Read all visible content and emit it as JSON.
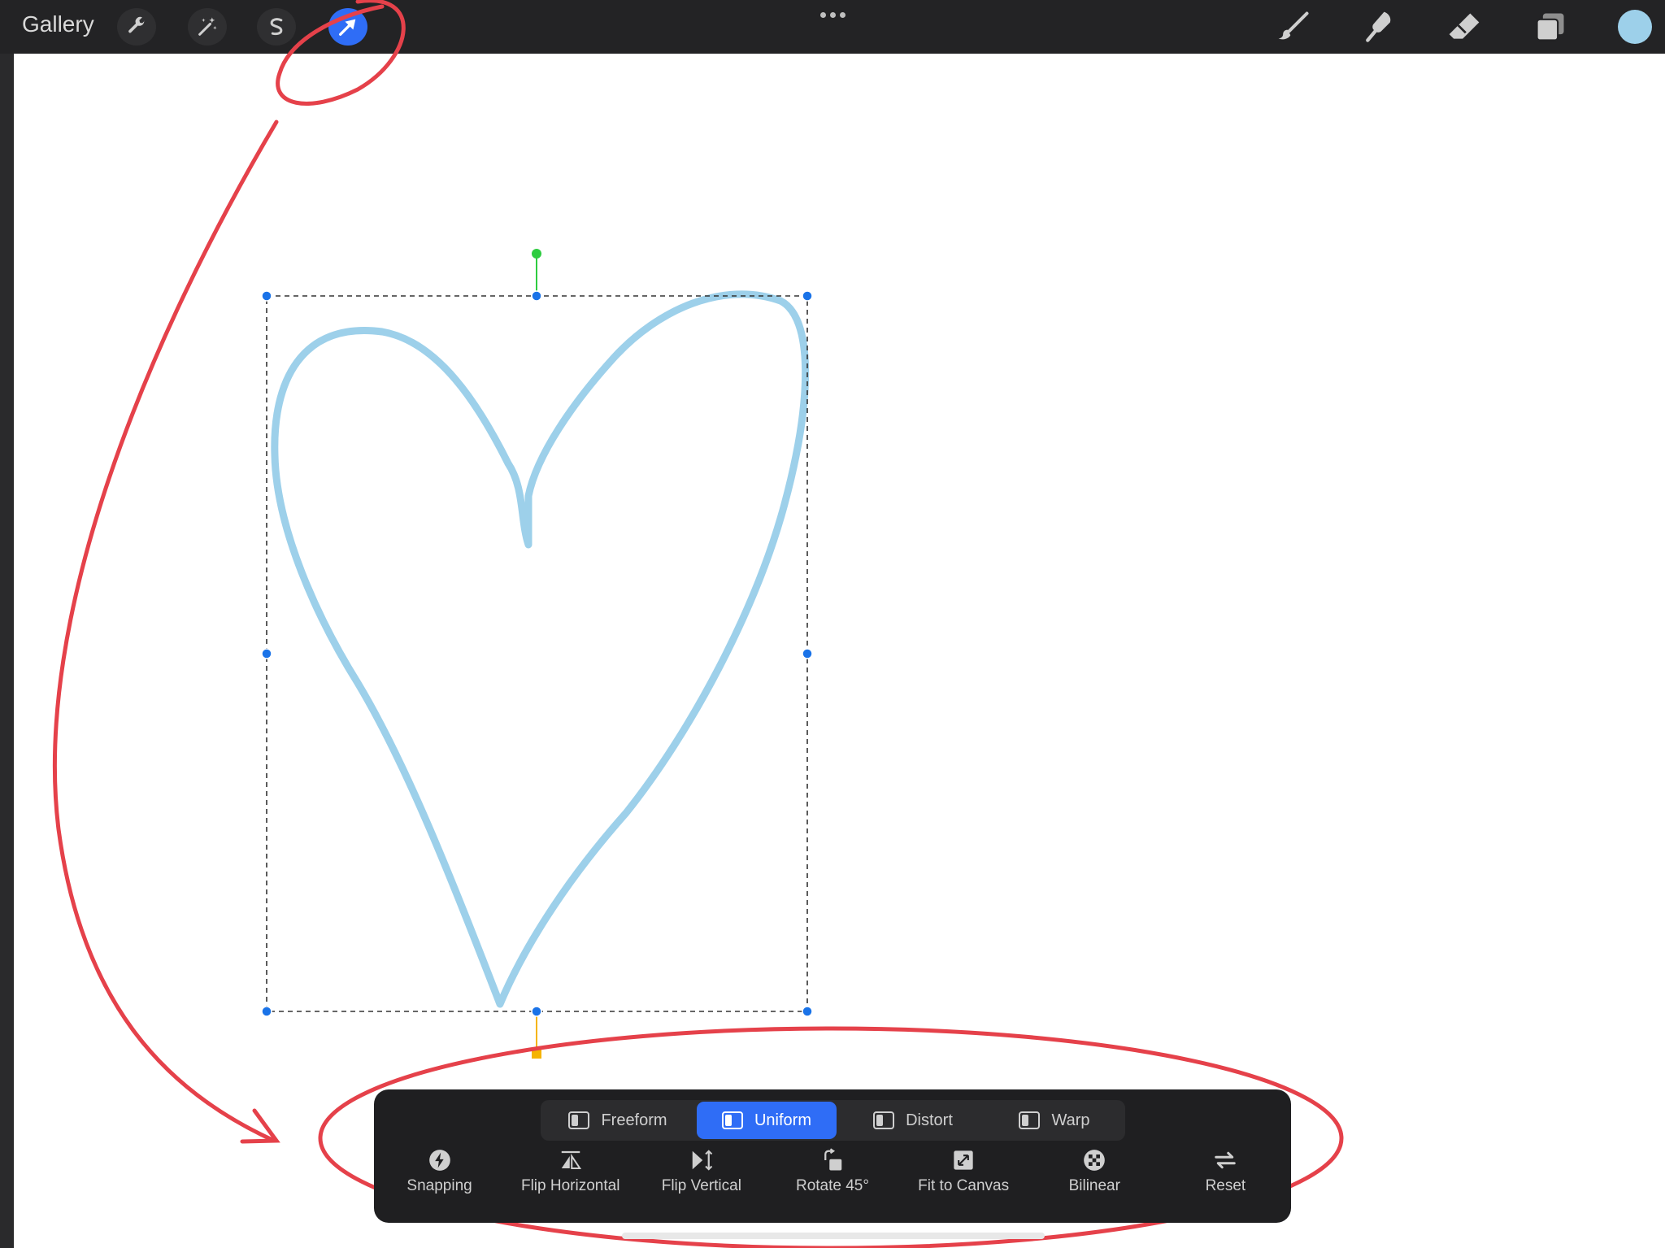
{
  "topbar": {
    "gallery_label": "Gallery",
    "left_tools": [
      "wrench-icon",
      "magic-wand-icon",
      "selection-icon",
      "transform-arrow-icon"
    ],
    "active_tool": "transform-arrow-icon",
    "right_tools": [
      "brush-icon",
      "smudge-icon",
      "eraser-icon",
      "layers-icon"
    ],
    "current_color": "#9dd0ea"
  },
  "canvas": {
    "stroke_color": "#9dd0ea",
    "selection_handle_color": "#1a73e8",
    "rotation_handle_color": "#2ecc40",
    "pivot_handle_color": "#f5b400",
    "annotation_color": "#e5414a"
  },
  "transform_panel": {
    "modes": [
      "Freeform",
      "Uniform",
      "Distort",
      "Warp"
    ],
    "active_mode": "Uniform",
    "actions": [
      "Snapping",
      "Flip Horizontal",
      "Flip Vertical",
      "Rotate 45°",
      "Fit to Canvas",
      "Bilinear",
      "Reset"
    ]
  }
}
